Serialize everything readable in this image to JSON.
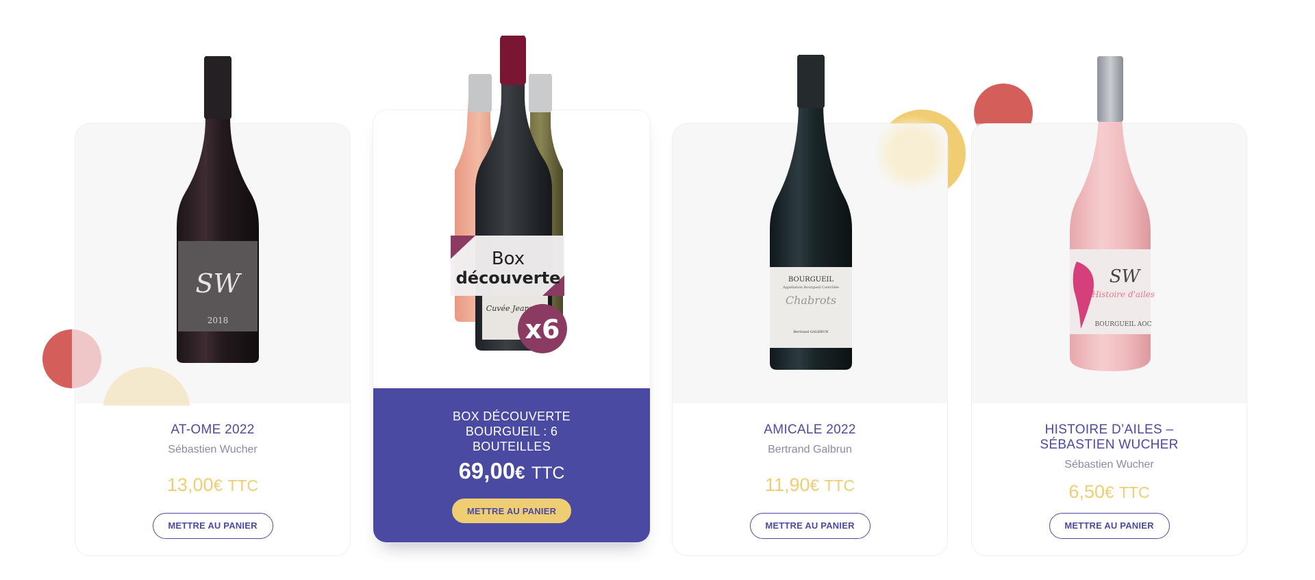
{
  "colors": {
    "accent": "#4b4aa3",
    "price": "#efcd72",
    "image_bg": "#f7f7f7",
    "badge": "#8b3b62"
  },
  "products": [
    {
      "name": "AT-OME 2022",
      "producer": "Sébastien Wucher",
      "price": "13,00",
      "currency": "€",
      "tax": "TTC",
      "button": "METTRE AU PANIER",
      "label": {
        "monogram": "SW",
        "year": "2018"
      }
    },
    {
      "name_line1": "BOX DÉCOUVERTE",
      "name_line2": "BOURGUEIL : 6",
      "name_line3": "BOUTEILLES",
      "price": "69,00",
      "currency": "€",
      "tax": "TTC",
      "button": "METTRE AU PANIER",
      "box_label_1": "Box",
      "box_label_2": "découverte",
      "quantity_badge": "x6",
      "label": {
        "cuvee": "Cuvée Jeanne"
      }
    },
    {
      "name": "AMICALE 2022",
      "producer": "Bertrand Galbrun",
      "price": "11,90",
      "currency": "€",
      "tax": "TTC",
      "button": "METTRE AU PANIER",
      "label": {
        "appellation": "BOURGUEIL",
        "sub": "Appellation Bourgueil Contrôlée",
        "cuvee": "Chabrots",
        "bottler": "Bertrand GALBRUN"
      }
    },
    {
      "name_line1": "HISTOIRE D’AILES –",
      "name_line2": "SÉBASTIEN WUCHER",
      "producer": "Sébastien Wucher",
      "price": "6,50",
      "currency": "€",
      "tax": "TTC",
      "button": "METTRE AU PANIER",
      "label": {
        "monogram": "SW",
        "script": "Histoire d'ailes",
        "appellation": "BOURGUEIL AOC"
      }
    }
  ]
}
